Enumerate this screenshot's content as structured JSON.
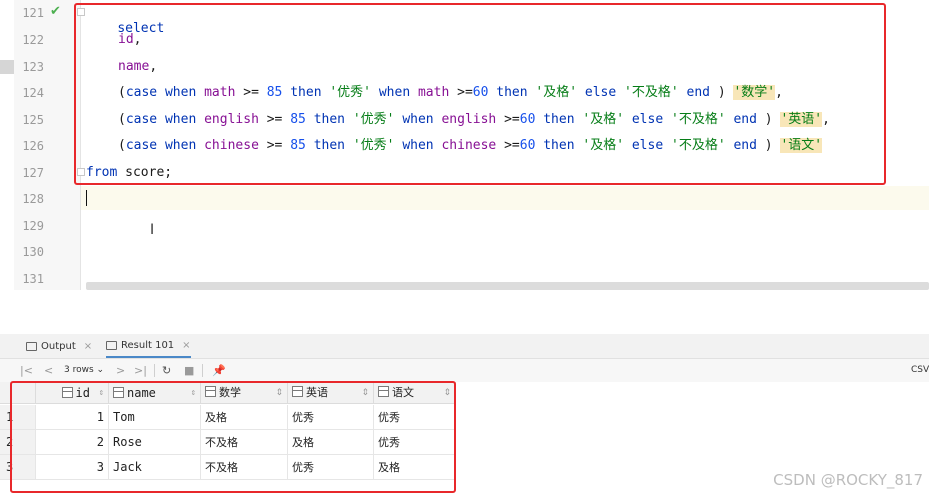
{
  "editor": {
    "line_numbers": [
      "121",
      "122",
      "123",
      "124",
      "125",
      "126",
      "127",
      "128",
      "129",
      "130",
      "131"
    ],
    "code": {
      "l121": {
        "kw": "select"
      },
      "l122": {
        "ident": "id",
        "punct": ","
      },
      "l123": {
        "ident": "name",
        "punct": ","
      },
      "l124": {
        "p1": "(",
        "case": "case",
        "when1": "when",
        "col1": "math",
        "op1": ">=",
        "n1": "85",
        "then1": "then",
        "s1": "'优秀'",
        "when2": "when",
        "col2": "math",
        "op2": ">=",
        "n2": "60",
        "then2": "then",
        "s2": "'及格'",
        "else": "else",
        "s3": "'不及格'",
        "end": "end",
        "p2": ")",
        "alias": "'数学'",
        "tail": ","
      },
      "l125": {
        "p1": "(",
        "case": "case",
        "when1": "when",
        "col1": "english",
        "op1": ">=",
        "n1": "85",
        "then1": "then",
        "s1": "'优秀'",
        "when2": "when",
        "col2": "english",
        "op2": ">=",
        "n2": "60",
        "then2": "then",
        "s2": "'及格'",
        "else": "else",
        "s3": "'不及格'",
        "end": "end",
        "p2": ")",
        "alias": "'英语'",
        "tail": ","
      },
      "l126": {
        "p1": "(",
        "case": "case",
        "when1": "when",
        "col1": "chinese",
        "op1": ">=",
        "n1": "85",
        "then1": "then",
        "s1": "'优秀'",
        "when2": "when",
        "col2": "chinese",
        "op2": ">=",
        "n2": "60",
        "then2": "then",
        "s2": "'及格'",
        "else": "else",
        "s3": "'不及格'",
        "end": "end",
        "p2": ")",
        "alias": "'语文'"
      },
      "l127": {
        "kw": "from",
        "rest": " score;"
      }
    }
  },
  "results": {
    "tabs": [
      {
        "label": "Output",
        "icon": "output-icon"
      },
      {
        "label": "Result 101",
        "icon": "table-icon"
      }
    ],
    "toolbar": {
      "rows_label": "3 rows",
      "export_label": "CSV",
      "icons": [
        "first-page-icon",
        "prev-page-icon",
        "rows-dropdown",
        "next-page-icon",
        "last-page-icon",
        "refresh-icon",
        "stop-icon",
        "pin-icon"
      ]
    },
    "columns": [
      "id",
      "name",
      "数学",
      "英语",
      "语文"
    ],
    "rows": [
      {
        "n": "1",
        "id": "1",
        "name": "Tom",
        "math": "及格",
        "english": "优秀",
        "chinese": "优秀"
      },
      {
        "n": "2",
        "id": "2",
        "name": "Rose",
        "math": "不及格",
        "english": "及格",
        "chinese": "优秀"
      },
      {
        "n": "3",
        "id": "3",
        "name": "Jack",
        "math": "不及格",
        "english": "优秀",
        "chinese": "及格"
      }
    ]
  },
  "watermark": "CSDN @ROCKY_817",
  "colors": {
    "keyword": "#0033b3",
    "identifier": "#871094",
    "number": "#1750eb",
    "string": "#067d17",
    "highlight_box": "#e8282b"
  }
}
